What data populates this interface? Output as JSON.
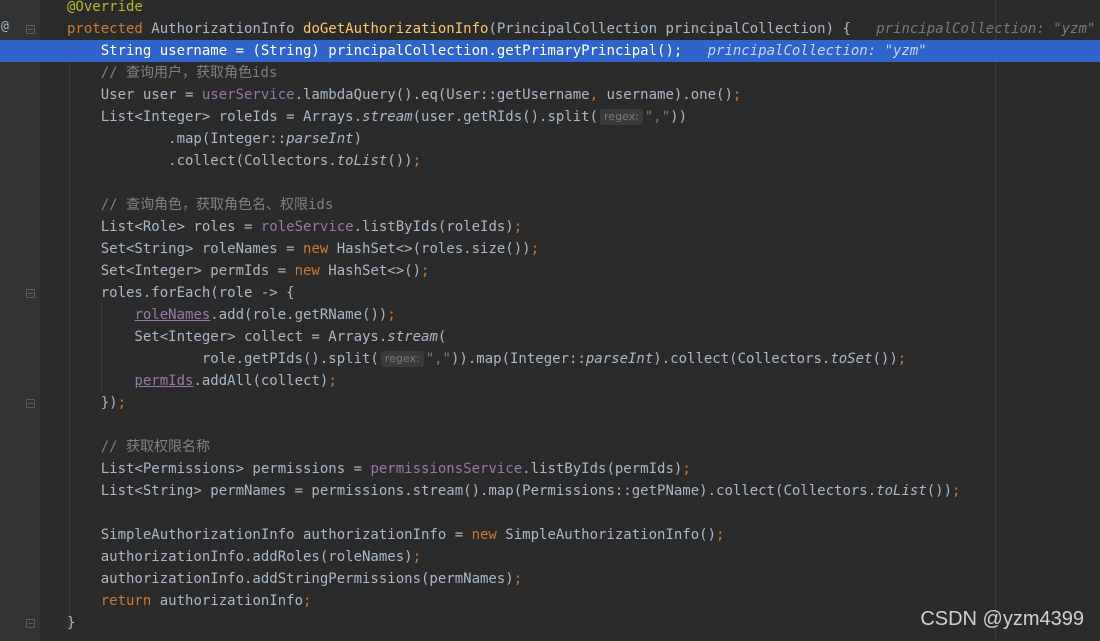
{
  "gutter": {
    "override_marker": "@"
  },
  "inline_values": {
    "method_param": "principalCollection: \"yzm\"",
    "username_line": "principalCollection: \"yzm\""
  },
  "hints": {
    "regex": "regex:"
  },
  "comments": {
    "query_user": "// 查询用户，获取角色ids",
    "query_role": "// 查询角色，获取角色名、权限ids",
    "get_perm_names": "// 获取权限名称"
  },
  "watermark": "CSDN @yzm4399",
  "colors": {
    "background": "#2b2b2b",
    "keyword": "#cc7832",
    "method": "#ffc66d",
    "field": "#9876aa",
    "comment": "#808080",
    "string": "#6a8759",
    "current_line": "#2f65ca",
    "breakpoint": "#c75450"
  }
}
